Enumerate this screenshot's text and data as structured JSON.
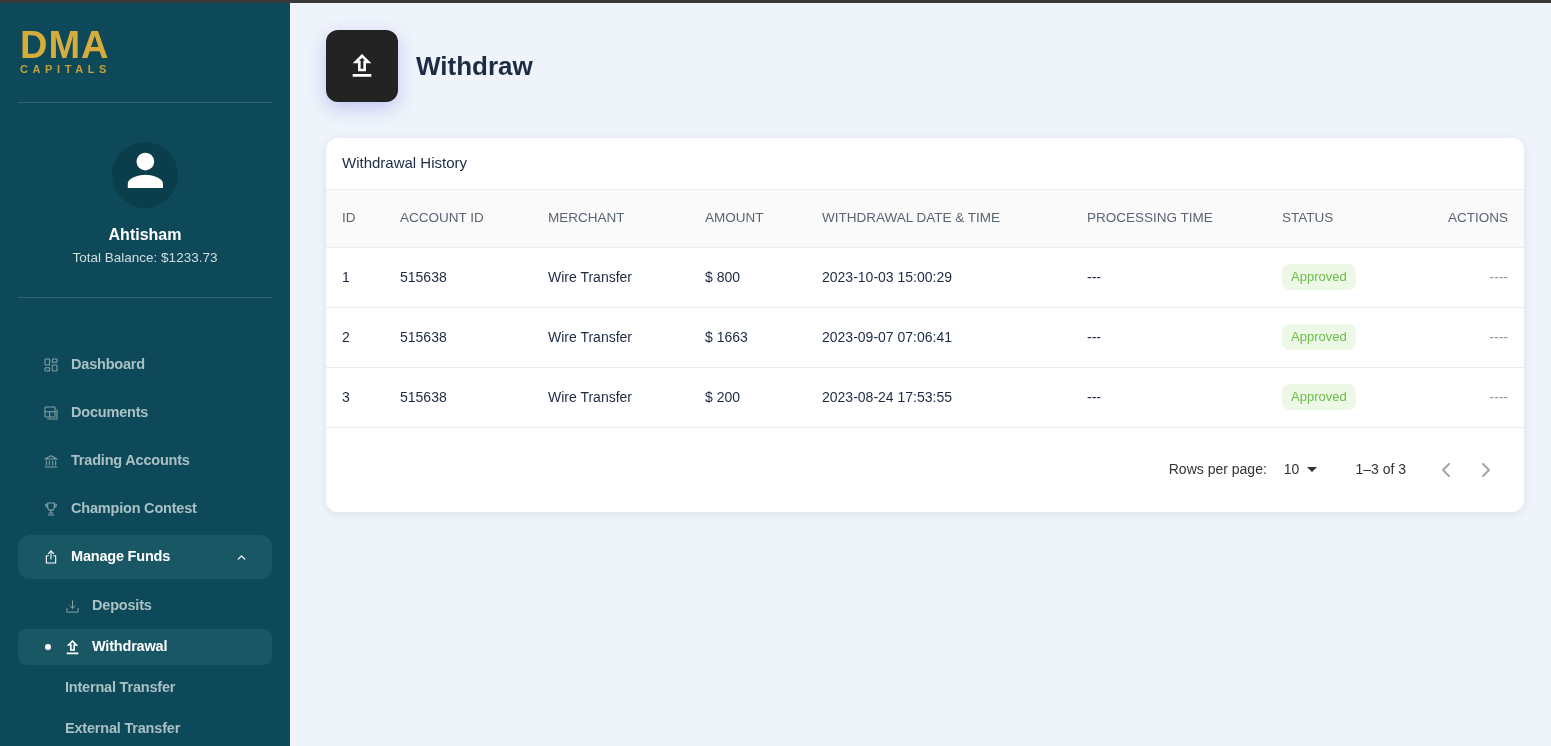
{
  "sidebar": {
    "logo": {
      "wordmark": "DMA",
      "tagline": "CAPITALS"
    },
    "user": {
      "name": "Ahtisham",
      "balance": "Total Balance: $1233.73"
    },
    "nav": [
      {
        "label": "Dashboard",
        "selected": false
      },
      {
        "label": "Documents",
        "selected": false
      },
      {
        "label": "Trading Accounts",
        "selected": false
      },
      {
        "label": "Champion Contest",
        "selected": false
      },
      {
        "label": "Manage Funds",
        "selected": true,
        "expanded": true,
        "children": [
          {
            "label": "Deposits",
            "selected": false
          },
          {
            "label": "Withdrawal",
            "selected": true
          },
          {
            "label": "Internal Transfer",
            "selected": false
          },
          {
            "label": "External Transfer",
            "selected": false
          }
        ]
      }
    ]
  },
  "page": {
    "title": "Withdraw"
  },
  "card": {
    "title": "Withdrawal History",
    "table": {
      "columns": [
        "ID",
        "ACCOUNT ID",
        "MERCHANT",
        "AMOUNT",
        "WITHDRAWAL DATE & TIME",
        "PROCESSING TIME",
        "STATUS",
        "ACTIONS"
      ],
      "rows": [
        {
          "id": "1",
          "account_id": "515638",
          "merchant": "Wire Transfer",
          "amount": "$ 800",
          "date_time": "2023-10-03 15:00:29",
          "processing_time": "---",
          "status": "Approved",
          "actions": "----"
        },
        {
          "id": "2",
          "account_id": "515638",
          "merchant": "Wire Transfer",
          "amount": "$ 1663",
          "date_time": "2023-09-07 07:06:41",
          "processing_time": "---",
          "status": "Approved",
          "actions": "----"
        },
        {
          "id": "3",
          "account_id": "515638",
          "merchant": "Wire Transfer",
          "amount": "$ 200",
          "date_time": "2023-08-24 17:53:55",
          "processing_time": "---",
          "status": "Approved",
          "actions": "----"
        }
      ]
    },
    "pagination": {
      "rows_per_page_label": "Rows per page:",
      "rows_per_page": "10",
      "range": "1–3 of 3",
      "prev": {
        "disabled": true
      },
      "next": {
        "disabled": true
      }
    }
  }
}
